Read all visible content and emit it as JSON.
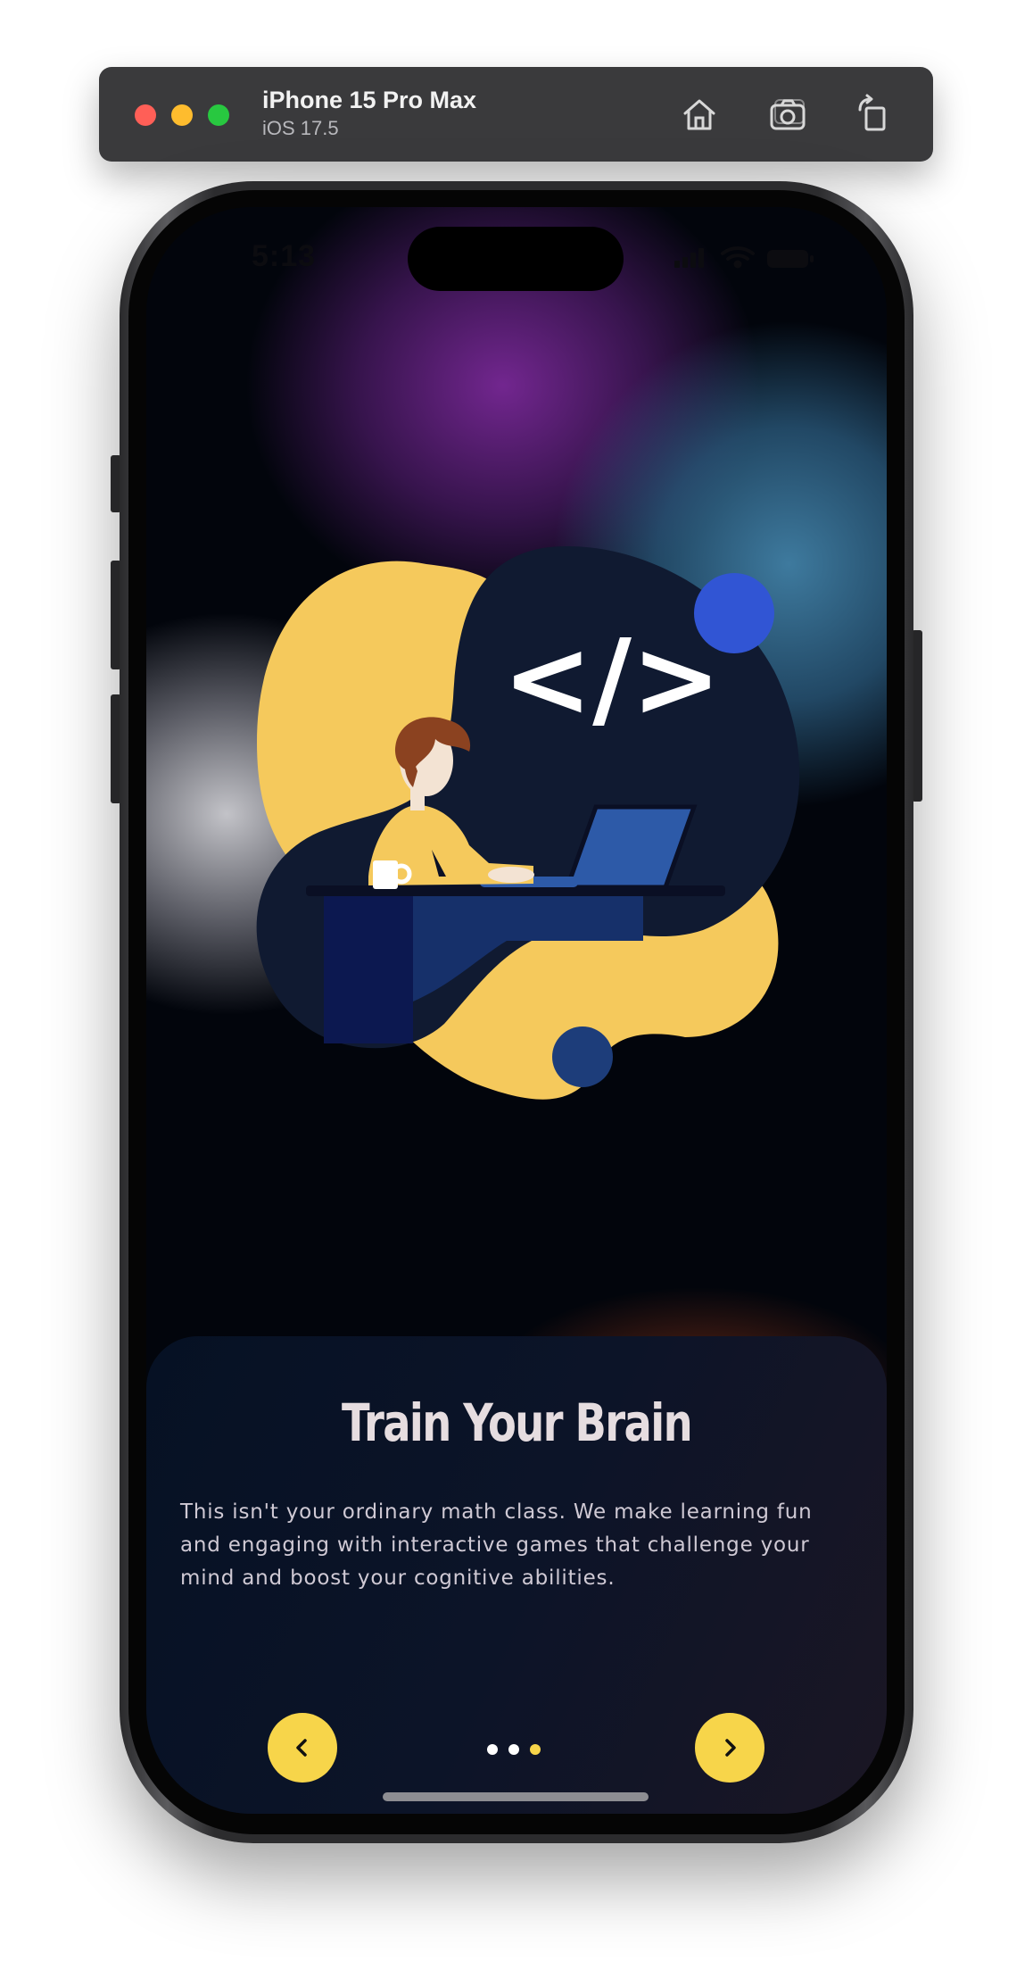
{
  "simulator": {
    "device_name": "iPhone 15 Pro Max",
    "os_version": "iOS 17.5",
    "buttons": [
      "home-icon",
      "screenshot-icon",
      "rotate-icon"
    ]
  },
  "status_bar": {
    "time": "5:13"
  },
  "illustration": {
    "code_symbol": "</>"
  },
  "onboarding": {
    "title": "Train Your Brain",
    "body": "This isn't your ordinary math class. We make learning fun and engaging with interactive games that challenge your mind and boost your cognitive abilities.",
    "page_count": 3,
    "current_page": 3,
    "prev_icon": "chevron-left-icon",
    "next_icon": "chevron-right-icon"
  },
  "colors": {
    "accent": "#f7d54a",
    "dot_inactive": "#ffffff",
    "card_bg": "#0c1428",
    "illustration_navy": "#101a31",
    "illustration_yellow": "#f5c95c",
    "illustration_blue": "#3155d4"
  }
}
